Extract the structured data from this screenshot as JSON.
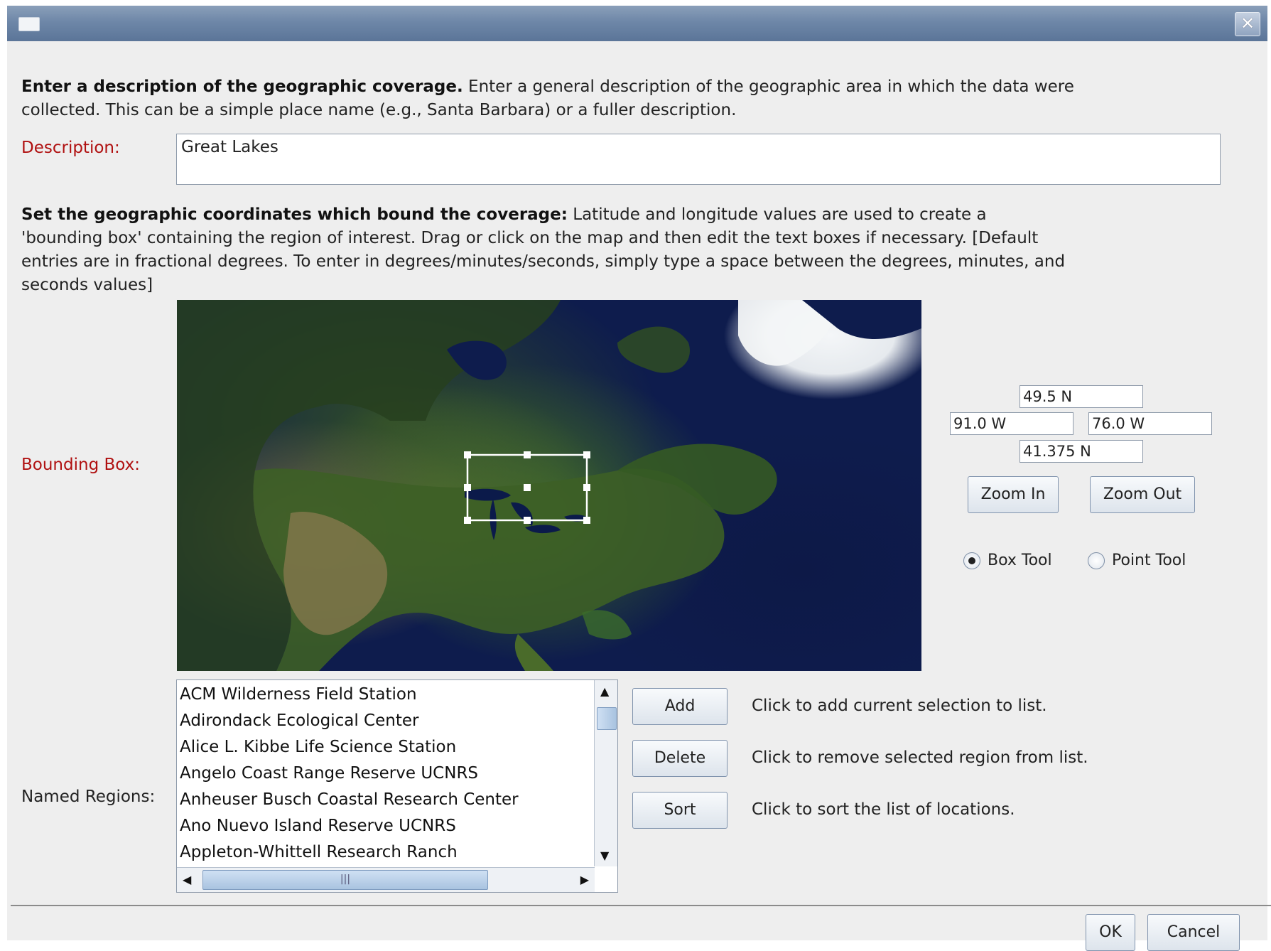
{
  "window": {
    "close_label": "✕"
  },
  "intro": {
    "bold": "Enter a description of the geographic coverage.",
    "text": " Enter a general description of the geographic area in which the data were collected. This can be a simple place name (e.g., Santa Barbara) or a fuller description."
  },
  "description": {
    "label": "Description:",
    "value": "Great Lakes"
  },
  "coords_intro": {
    "bold": "Set the geographic coordinates  which bound the coverage:",
    "text": " Latitude and longitude values are used to create a 'bounding box' containing the region of interest. Drag or click on the map and then edit the text boxes if necessary. [Default entries are in fractional degrees. To enter in degrees/minutes/seconds, simply type a space between the degrees, minutes, and seconds values]"
  },
  "bounding_box": {
    "label": "Bounding Box:",
    "north": "49.5 N",
    "west": "91.0 W",
    "east": "76.0 W",
    "south": "41.375 N",
    "zoom_in": "Zoom In",
    "zoom_out": "Zoom Out",
    "box_tool": "Box Tool",
    "point_tool": "Point Tool",
    "selected_tool": "box"
  },
  "named_regions": {
    "label": "Named Regions:",
    "items": [
      "ACM Wilderness Field Station",
      "Adirondack Ecological Center",
      "Alice L. Kibbe Life Science Station",
      "Angelo Coast Range Reserve UCNRS",
      "Anheuser Busch Coastal Research Center",
      "Ano Nuevo Island Reserve UCNRS",
      "Appleton-Whittell Research Ranch"
    ],
    "add_label": "Add",
    "delete_label": "Delete",
    "sort_label": "Sort",
    "add_hint": "Click to add current selection to list.",
    "delete_hint": "Click to remove selected region from list.",
    "sort_hint": "Click to sort the list of locations."
  },
  "footer": {
    "ok": "OK",
    "cancel": "Cancel"
  },
  "icons": [
    "window-icon",
    "close-icon",
    "scroll-up-icon",
    "scroll-down-icon",
    "scroll-left-icon",
    "scroll-right-icon"
  ]
}
